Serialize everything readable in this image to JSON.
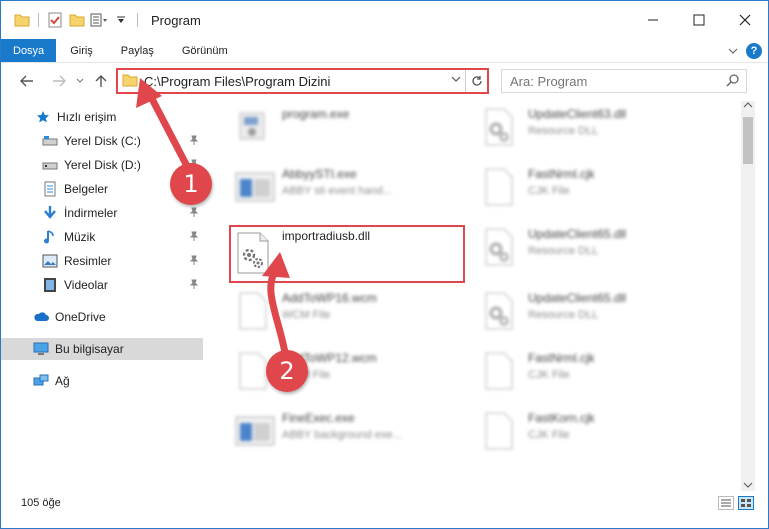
{
  "window": {
    "title": "Program"
  },
  "ribbon": {
    "tabs": [
      "Dosya",
      "Giriş",
      "Paylaş",
      "Görünüm"
    ]
  },
  "address": {
    "path": "C:\\Program Files\\Program Dizini",
    "search_placeholder": "Ara: Program"
  },
  "sidebar": {
    "items": [
      {
        "label": "Hızlı erişim"
      },
      {
        "label": "Yerel Disk (C:)"
      },
      {
        "label": "Yerel Disk (D:)"
      },
      {
        "label": "Belgeler"
      },
      {
        "label": "İndirmeler"
      },
      {
        "label": "Müzik"
      },
      {
        "label": "Resimler"
      },
      {
        "label": "Videolar"
      },
      {
        "label": "OneDrive"
      },
      {
        "label": "Bu bilgisayar"
      },
      {
        "label": "Ağ"
      }
    ]
  },
  "files_left": [
    {
      "name": "program.exe",
      "type": ""
    },
    {
      "name": "AbbyySTI.exe",
      "type": "ABBY sti event hand..."
    },
    {
      "name": "importradiusb.dll",
      "type": ""
    },
    {
      "name": "AddToWP16.wcm",
      "type": "WCM File"
    },
    {
      "name": "AddToWP12.wcm",
      "type": "WCM File"
    },
    {
      "name": "FineExec.exe",
      "type": "ABBY background exe..."
    }
  ],
  "files_right": [
    {
      "name": "UpdateClient63.dll",
      "type": "Resource DLL"
    },
    {
      "name": "FastNrml.cjk",
      "type": "CJK File"
    },
    {
      "name": "UpdateClient65.dll",
      "type": "Resource DLL"
    },
    {
      "name": "UpdateClient65.dll",
      "type": "Resource DLL"
    },
    {
      "name": "FastNrml.cjk",
      "type": "CJK File"
    },
    {
      "name": "FastKorn.cjk",
      "type": "CJK File"
    }
  ],
  "status": {
    "count": "105 öğe"
  },
  "callouts": {
    "one": "1",
    "two": "2"
  },
  "colors": {
    "accent": "#1979ca",
    "highlight": "#e0474c"
  }
}
